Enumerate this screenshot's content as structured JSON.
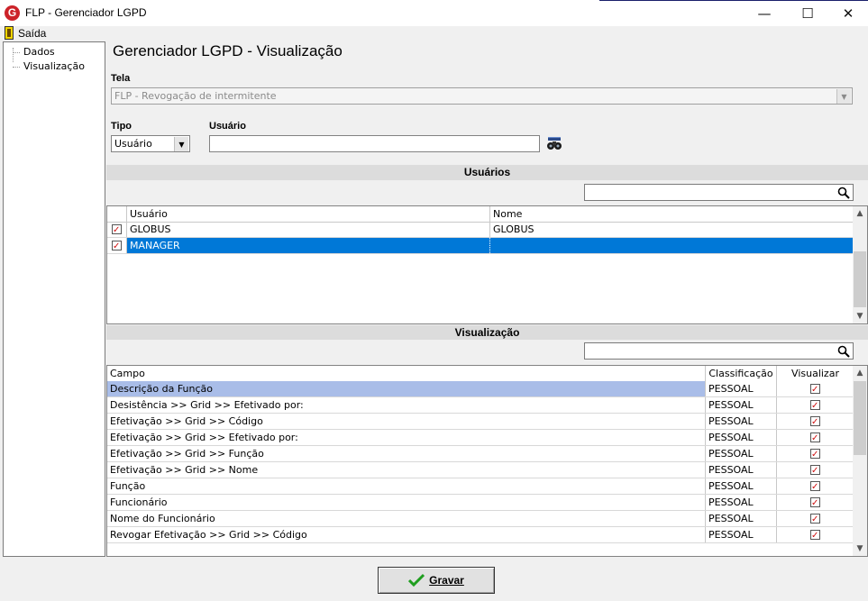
{
  "window": {
    "logo_letter": "G",
    "title": "FLP - Gerenciador LGPD",
    "minimize": "—",
    "maximize": "☐",
    "close": "✕"
  },
  "menu": {
    "exit": "Saída"
  },
  "tree": {
    "items": [
      "Dados",
      "Visualização"
    ]
  },
  "page": {
    "title": "Gerenciador LGPD - Visualização"
  },
  "tela": {
    "label": "Tela",
    "value": "FLP - Revogação de intermitente"
  },
  "tipo": {
    "label": "Tipo",
    "value": "Usuário"
  },
  "usuario": {
    "label": "Usuário",
    "value": ""
  },
  "usuarios_section": {
    "title": "Usuários",
    "columns": [
      "Usuário",
      "Nome"
    ],
    "rows": [
      {
        "usuario": "GLOBUS",
        "nome": "GLOBUS",
        "checked": true,
        "selected": false
      },
      {
        "usuario": "MANAGER",
        "nome": "",
        "checked": true,
        "selected": true
      }
    ]
  },
  "visualizacao_section": {
    "title": "Visualização",
    "columns": [
      "Campo",
      "Classificação",
      "Visualizar"
    ],
    "rows": [
      {
        "campo": "Descrição da Função",
        "classificacao": "PESSOAL",
        "visualizar": true
      },
      {
        "campo": "Desistência >> Grid >> Efetivado por:",
        "classificacao": "PESSOAL",
        "visualizar": true
      },
      {
        "campo": "Efetivação >> Grid >> Código",
        "classificacao": "PESSOAL",
        "visualizar": true
      },
      {
        "campo": "Efetivação >> Grid >> Efetivado por:",
        "classificacao": "PESSOAL",
        "visualizar": true
      },
      {
        "campo": "Efetivação >> Grid >> Função",
        "classificacao": "PESSOAL",
        "visualizar": true
      },
      {
        "campo": "Efetivação >> Grid >> Nome",
        "classificacao": "PESSOAL",
        "visualizar": true
      },
      {
        "campo": "Função",
        "classificacao": "PESSOAL",
        "visualizar": true
      },
      {
        "campo": "Funcionário",
        "classificacao": "PESSOAL",
        "visualizar": true
      },
      {
        "campo": "Nome do Funcionário",
        "classificacao": "PESSOAL",
        "visualizar": true
      },
      {
        "campo": "Revogar Efetivação >> Grid >> Código",
        "classificacao": "PESSOAL",
        "visualizar": true
      }
    ]
  },
  "actions": {
    "save_label": "Gravar"
  },
  "colors": {
    "selection": "#0078d7",
    "highlight_row": "#a9bde8",
    "check": "#d01010",
    "logo": "#cc2229"
  },
  "icons": {
    "exit": "exit-door-icon",
    "lookup": "binoculars-icon",
    "search": "search-icon",
    "save": "checkmark-icon"
  }
}
